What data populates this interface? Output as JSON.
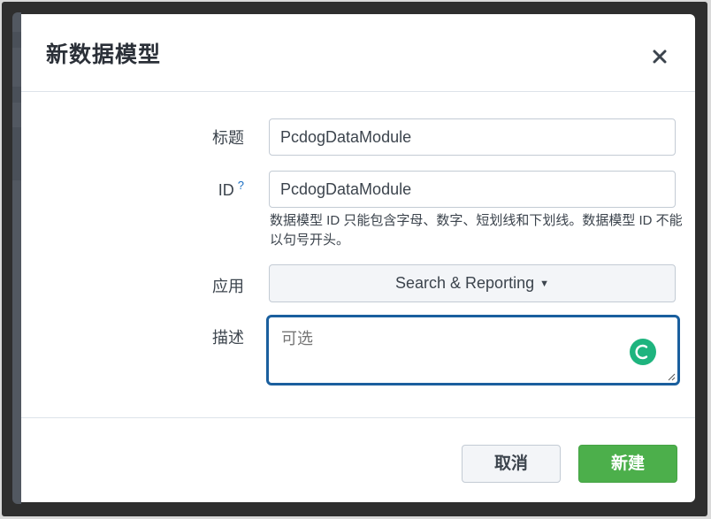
{
  "dialog": {
    "title": "新数据模型",
    "close_icon": "close-icon"
  },
  "form": {
    "title_field": {
      "label": "标题",
      "value": "PcdogDataModule"
    },
    "id_field": {
      "label": "ID",
      "help_mark": "?",
      "value": "PcdogDataModule",
      "help_text": "数据模型 ID 只能包含字母、数字、短划线和下划线。数据模型 ID 不能以句号开头。"
    },
    "app_field": {
      "label": "应用",
      "selected": "Search & Reporting",
      "caret_icon": "caret-down-icon"
    },
    "description_field": {
      "label": "描述",
      "placeholder": "可选",
      "value": ""
    }
  },
  "footer": {
    "cancel_label": "取消",
    "create_label": "新建"
  },
  "colors": {
    "primary_button": "#4caf4b",
    "focus_border": "#1a5f9e",
    "help_link": "#1a6ec2",
    "grammar_badge": "#1eb47e"
  }
}
